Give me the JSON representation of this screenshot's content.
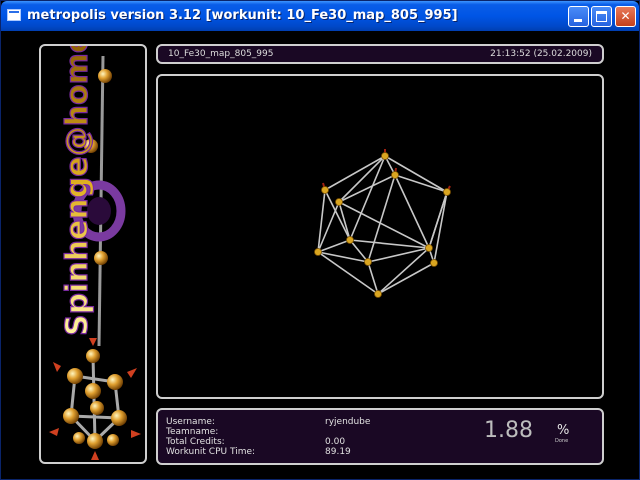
{
  "window": {
    "title": "metropolis version 3.12 [workunit: 10_Fe30_map_805_995]",
    "minimize_glyph": "",
    "maximize_glyph": "",
    "close_glyph": "✕"
  },
  "header": {
    "workunit": "10_Fe30_map_805_995",
    "timestamp": "21:13:52 (25.02.2009)"
  },
  "logo": {
    "text": "Spinhenge@home"
  },
  "stats": {
    "username_label": "Username:",
    "username_value": "ryjendube",
    "teamname_label": "Teamname:",
    "teamname_value": "",
    "credits_label": "Total Credits:",
    "credits_value": "0.00",
    "cpu_label": "Workunit CPU Time:",
    "cpu_value": "89.19",
    "percent_value": "1.88",
    "percent_sign": "%",
    "done_label": "Done"
  },
  "colors": {
    "title_bar": "#0055e5",
    "panel_border": "#cfcfcf",
    "panel_fill": "#1a0824",
    "node": "#d9a520",
    "edge": "#c8c8c8"
  }
}
